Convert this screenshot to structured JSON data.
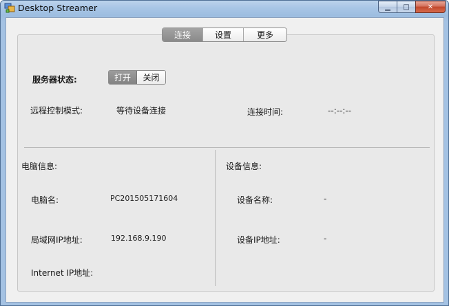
{
  "window": {
    "title": "Desktop Streamer",
    "min_label": "▁",
    "max_label": "□",
    "close_label": "✕"
  },
  "tabs": [
    {
      "label": "连接",
      "active": true
    },
    {
      "label": "设置",
      "active": false
    },
    {
      "label": "更多",
      "active": false
    }
  ],
  "server": {
    "label": "服务器状态:",
    "on_label": "打开",
    "off_label": "关闭",
    "selected": "打开"
  },
  "remote": {
    "mode_label": "远程控制模式:",
    "mode_value": "等待设备连接",
    "time_label": "连接时间:",
    "time_value": "--:--:--"
  },
  "computer": {
    "section_label": "电脑信息:",
    "name_label": "电脑名:",
    "name_value": "PC201505171604",
    "lan_ip_label": "局域网IP地址:",
    "lan_ip_value": "192.168.9.190",
    "internet_ip_label": "Internet IP地址:"
  },
  "device": {
    "section_label": "设备信息:",
    "name_label": "设备名称:",
    "name_value": "-",
    "ip_label": "设备IP地址:",
    "ip_value": "-"
  },
  "colors": {
    "titlebar": "#a4c2e3",
    "active_tab": "#8a8a8a",
    "close_button": "#c2472c"
  }
}
